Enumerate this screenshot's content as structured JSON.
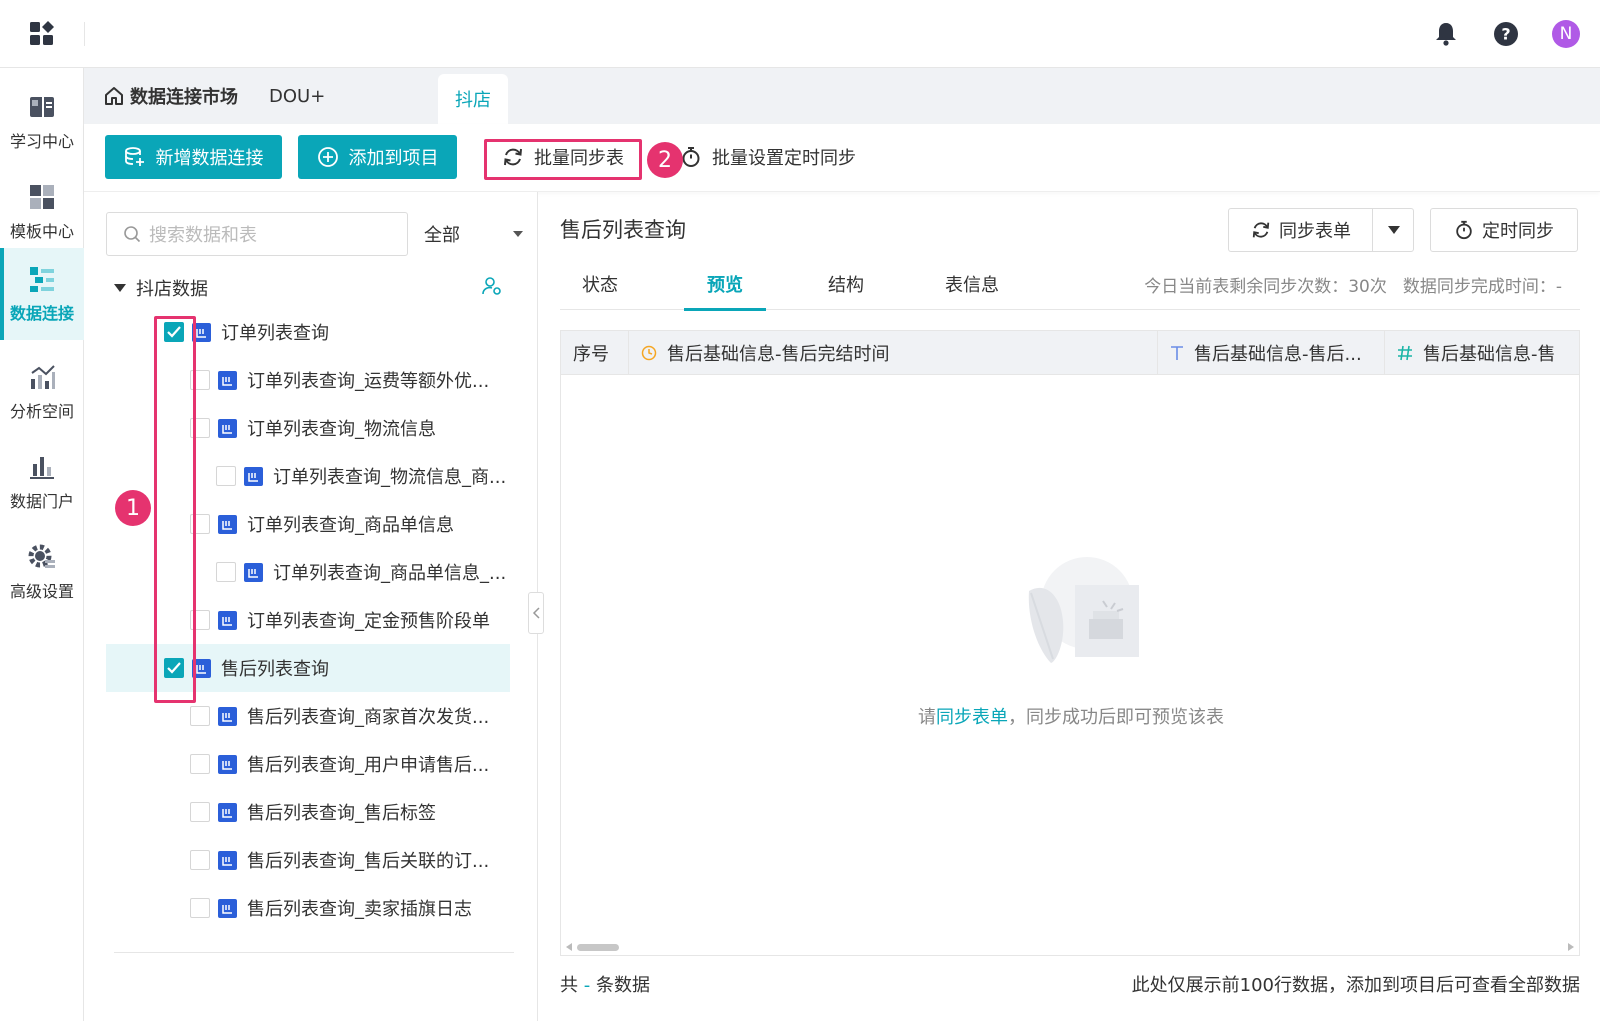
{
  "top": {
    "avatar_letter": "N",
    "icons": [
      "apps-icon",
      "bell-icon",
      "help-icon"
    ]
  },
  "sidebar": {
    "items": [
      {
        "label": "学习中心",
        "icon": "book-icon"
      },
      {
        "label": "模板中心",
        "icon": "template-icon"
      },
      {
        "label": "数据连接",
        "icon": "data-connect-icon",
        "active": true
      },
      {
        "label": "分析空间",
        "icon": "analysis-icon"
      },
      {
        "label": "数据门户",
        "icon": "portal-icon"
      },
      {
        "label": "高级设置",
        "icon": "gear-icon"
      }
    ]
  },
  "breadcrumb": {
    "home": "数据连接市场",
    "item": "DOU+",
    "active_tab": "抖店"
  },
  "toolbar": {
    "add_connection": "新增数据连接",
    "add_to_project": "添加到项目",
    "batch_sync": "批量同步表",
    "batch_schedule": "批量设置定时同步"
  },
  "annotations": {
    "one": "1",
    "two": "2"
  },
  "left": {
    "search_placeholder": "搜索数据和表",
    "filter_value": "全部",
    "root_label": "抖店数据",
    "items": [
      {
        "label": "订单列表查询",
        "checked": true
      },
      {
        "label": "订单列表查询_运费等额外优..."
      },
      {
        "label": "订单列表查询_物流信息"
      },
      {
        "label": "订单列表查询_物流信息_商..."
      },
      {
        "label": "订单列表查询_商品单信息"
      },
      {
        "label": "订单列表查询_商品单信息_..."
      },
      {
        "label": "订单列表查询_定金预售阶段单"
      },
      {
        "label": "售后列表查询",
        "checked": true,
        "selected": true
      },
      {
        "label": "售后列表查询_商家首次发货..."
      },
      {
        "label": "售后列表查询_用户申请售后..."
      },
      {
        "label": "售后列表查询_售后标签"
      },
      {
        "label": "售后列表查询_售后关联的订..."
      },
      {
        "label": "售后列表查询_卖家插旗日志"
      }
    ]
  },
  "right": {
    "title": "售后列表查询",
    "sync_button": "同步表单",
    "schedule_button": "定时同步",
    "tabs": [
      "状态",
      "预览",
      "结构",
      "表信息"
    ],
    "active_tab": "预览",
    "remaining": "今日当前表剩余同步次数：30次",
    "sync_time": "数据同步完成时间：-",
    "columns": [
      {
        "label": "序号",
        "type_icon": ""
      },
      {
        "label": "售后基础信息-售后完结时间",
        "type_icon": "clock-icon"
      },
      {
        "label": "售后基础信息-售后...",
        "type_icon": "text-type-icon"
      },
      {
        "label": "售后基础信息-售",
        "type_icon": "number-type-icon"
      }
    ],
    "empty": {
      "prefix": "请",
      "link": "同步表单",
      "suffix": "，同步成功后即可预览该表"
    },
    "footer_left_a": "共",
    "footer_left_b": "-",
    "footer_left_c": "条数据",
    "footer_right": "此处仅展示前100行数据，添加到项目后可查看全部数据"
  },
  "colors": {
    "accent": "#0aa6b8",
    "annotation": "#e5336f",
    "table_icon": "#2b5fd9"
  }
}
